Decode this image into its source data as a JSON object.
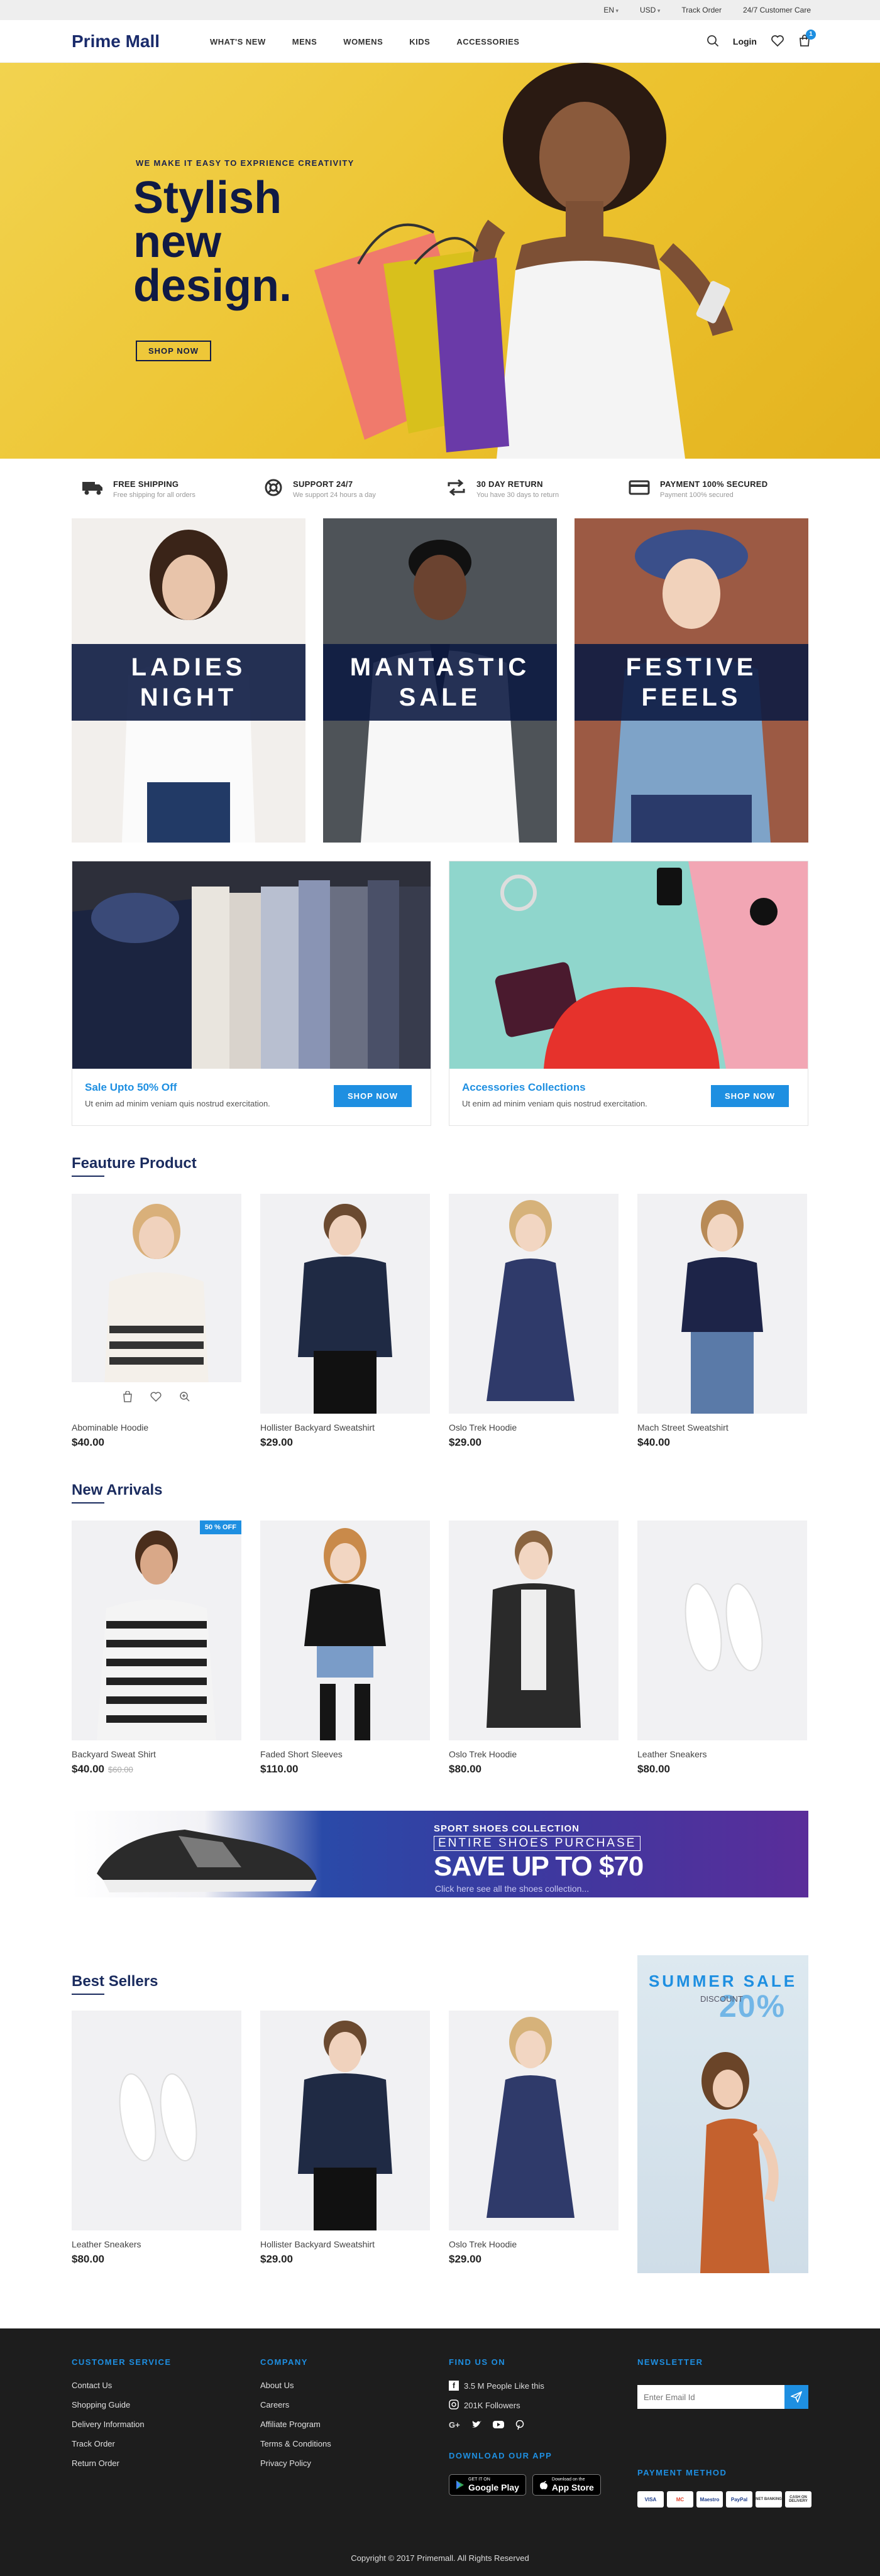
{
  "topbar": {
    "language": "EN",
    "currency": "USD",
    "track_order": "Track Order",
    "customer_care": "24/7 Customer Care"
  },
  "header": {
    "logo": "Prime Mall",
    "nav": [
      "WHAT'S NEW",
      "MENS",
      "WOMENS",
      "KIDS",
      "ACCESSORIES"
    ],
    "login": "Login",
    "cart_count": "1"
  },
  "hero": {
    "tagline": "WE MAKE IT EASY TO EXPRIENCE CREATIVITY",
    "title": "Stylish new design.",
    "button": "SHOP NOW"
  },
  "features": [
    {
      "icon": "truck-icon",
      "title": "FREE SHIPPING",
      "subtitle": "Free shipping for all orders"
    },
    {
      "icon": "lifebuoy-icon",
      "title": "SUPPORT 24/7",
      "subtitle": "We support 24 hours a day"
    },
    {
      "icon": "return-icon",
      "title": "30 DAY RETURN",
      "subtitle": "You have 30 days to return"
    },
    {
      "icon": "credit-card-icon",
      "title": "PAYMENT 100% SECURED",
      "subtitle": "Payment 100% secured"
    }
  ],
  "promos": [
    "LADIES\nNIGHT",
    "MANTASTIC\nSALE",
    "FESTIVE\nFEELS"
  ],
  "banners": [
    {
      "title": "Sale Upto 50% Off",
      "text": "Ut enim ad minim veniam quis nostrud exercitation.",
      "button": "SHOP NOW"
    },
    {
      "title": "Accessories Collections",
      "text": "Ut enim ad minim veniam quis nostrud exercitation.",
      "button": "SHOP NOW"
    }
  ],
  "featured": {
    "title": "Feauture Product",
    "items": [
      {
        "name": "Abominable Hoodie",
        "price": "$40.00"
      },
      {
        "name": "Hollister Backyard Sweatshirt",
        "price": "$29.00"
      },
      {
        "name": "Oslo Trek Hoodie",
        "price": "$29.00"
      },
      {
        "name": "Mach Street Sweatshirt",
        "price": "$40.00"
      }
    ]
  },
  "arrivals": {
    "title": "New Arrivals",
    "badge": "50 % OFF",
    "items": [
      {
        "name": "Backyard Sweat Shirt",
        "price": "$40.00",
        "old_price": "$60.00"
      },
      {
        "name": "Faded Short Sleeves",
        "price": "$110.00"
      },
      {
        "name": "Oslo Trek Hoodie",
        "price": "$80.00"
      },
      {
        "name": "Leather Sneakers",
        "price": "$80.00"
      }
    ]
  },
  "shoe_banner": {
    "kicker": "SPORT SHOES COLLECTION",
    "line": "ENTIRE SHOES PURCHASE",
    "headline": "SAVE UP TO $70",
    "sub": "Click here see all the shoes collection..."
  },
  "bestsellers": {
    "title": "Best Sellers",
    "items": [
      {
        "name": "Leather Sneakers",
        "price": "$80.00"
      },
      {
        "name": "Hollister Backyard Sweatshirt",
        "price": "$29.00"
      },
      {
        "name": "Oslo Trek Hoodie",
        "price": "$29.00"
      }
    ]
  },
  "summer": {
    "title": "SUMMER SALE",
    "discount_label": "DISCOUNT",
    "percent": "20%"
  },
  "footer": {
    "customer_service": {
      "title": "CUSTOMER SERVICE",
      "links": [
        "Contact Us",
        "Shopping Guide",
        "Delivery Information",
        "Track Order",
        "Return Order"
      ]
    },
    "company": {
      "title": "COMPANY",
      "links": [
        "About Us",
        "Careers",
        "Affiliate Program",
        "Terms & Conditions",
        "Privacy Policy"
      ]
    },
    "find_us": {
      "title": "FIND US ON",
      "facebook": "3.5 M People Like this",
      "instagram": "201K Followers"
    },
    "newsletter": {
      "title": "NEWSLETTER",
      "placeholder": "Enter Email Id"
    },
    "download": {
      "title": "DOWNLOAD OUR APP",
      "google_small": "GET IT ON",
      "google": "Google Play",
      "apple_small": "Download on the",
      "apple": "App Store"
    },
    "payment": {
      "title": "PAYMENT METHOD",
      "methods": [
        "VISA",
        "MC",
        "Maestro",
        "PayPal",
        "NET BANKING",
        "CASH ON DELIVERY"
      ]
    },
    "copyright": "Copyright © 2017 Primemall. All Rights Reserved"
  }
}
